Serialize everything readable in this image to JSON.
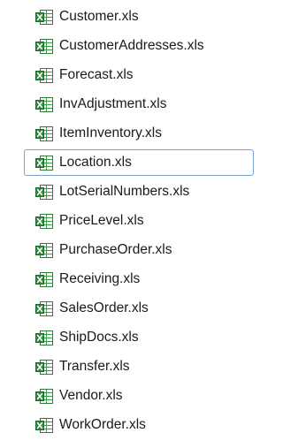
{
  "file_list": {
    "selected_index": 5,
    "icon": "excel-spreadsheet-icon",
    "colors": {
      "selection_border": "#7da2ce",
      "icon_green": "#2e8b3a",
      "icon_dark_green": "#1f6b2a"
    },
    "items": [
      {
        "label": "Customer.xls"
      },
      {
        "label": "CustomerAddresses.xls"
      },
      {
        "label": "Forecast.xls"
      },
      {
        "label": "InvAdjustment.xls"
      },
      {
        "label": "ItemInventory.xls"
      },
      {
        "label": "Location.xls"
      },
      {
        "label": "LotSerialNumbers.xls"
      },
      {
        "label": "PriceLevel.xls"
      },
      {
        "label": "PurchaseOrder.xls"
      },
      {
        "label": "Receiving.xls"
      },
      {
        "label": "SalesOrder.xls"
      },
      {
        "label": "ShipDocs.xls"
      },
      {
        "label": "Transfer.xls"
      },
      {
        "label": "Vendor.xls"
      },
      {
        "label": "WorkOrder.xls"
      }
    ]
  }
}
